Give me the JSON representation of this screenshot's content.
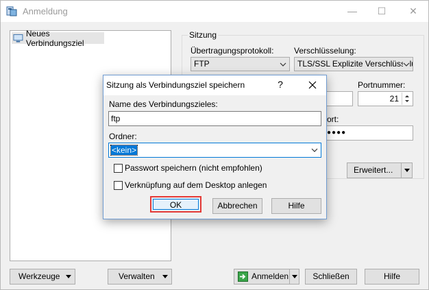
{
  "window": {
    "title": "Anmeldung",
    "minimize_glyph": "—",
    "maximize_glyph": "☐",
    "close_glyph": "✕"
  },
  "tree": {
    "items": [
      {
        "label": "Neues Verbindungsziel"
      }
    ]
  },
  "session": {
    "group_label": "Sitzung",
    "protocol_label": "Übertragungsprotokoll:",
    "protocol_value": "FTP",
    "encryption_label": "Verschlüsselung:",
    "encryption_value": "TLS/SSL Explizite Verschlüsselung",
    "port_label": "Portnummer:",
    "port_value": "21",
    "password_label_fragment": "ort:",
    "password_mask": "●●●●",
    "advanced_label": "Erweitert..."
  },
  "bottom_bar": {
    "tools_label": "Werkzeuge",
    "manage_label": "Verwalten",
    "login_label": "Anmelden",
    "close_label": "Schließen",
    "help_label": "Hilfe"
  },
  "dialog": {
    "title": "Sitzung als Verbindungsziel speichern",
    "help_glyph": "?",
    "name_label": "Name des Verbindungszieles:",
    "name_value": "ftp",
    "folder_label": "Ordner:",
    "folder_value": "<kein>",
    "save_password_label": "Passwort speichern (nicht empfohlen)",
    "desktop_shortcut_label": "Verknüpfung auf dem Desktop anlegen",
    "ok_label": "OK",
    "cancel_label": "Abbrechen",
    "help_label": "Hilfe"
  },
  "colors": {
    "accent_selection": "#0078d7",
    "highlight_border": "#e53935"
  }
}
